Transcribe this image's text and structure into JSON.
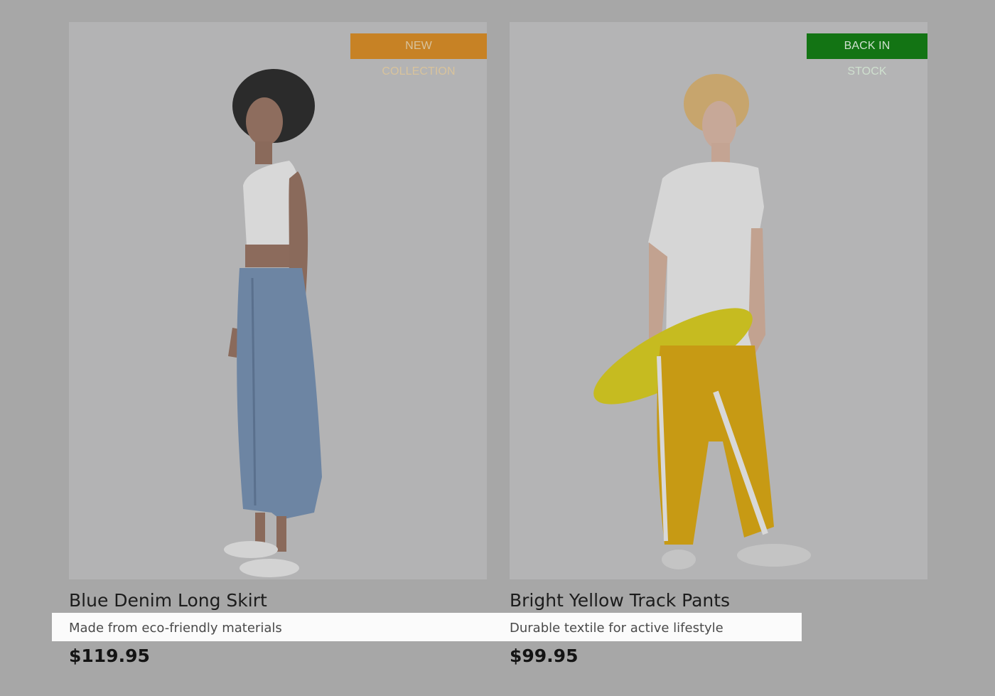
{
  "products": [
    {
      "badge": "NEW COLLECTION",
      "title": "Blue Denim Long Skirt",
      "description": "Made from eco-friendly materials",
      "price": "$119.95",
      "badge_color": "#c78225"
    },
    {
      "badge": "BACK IN STOCK",
      "title": "Bright Yellow Track Pants",
      "description": "Durable textile for active lifestyle",
      "price": "$99.95",
      "badge_color": "#137414"
    }
  ]
}
